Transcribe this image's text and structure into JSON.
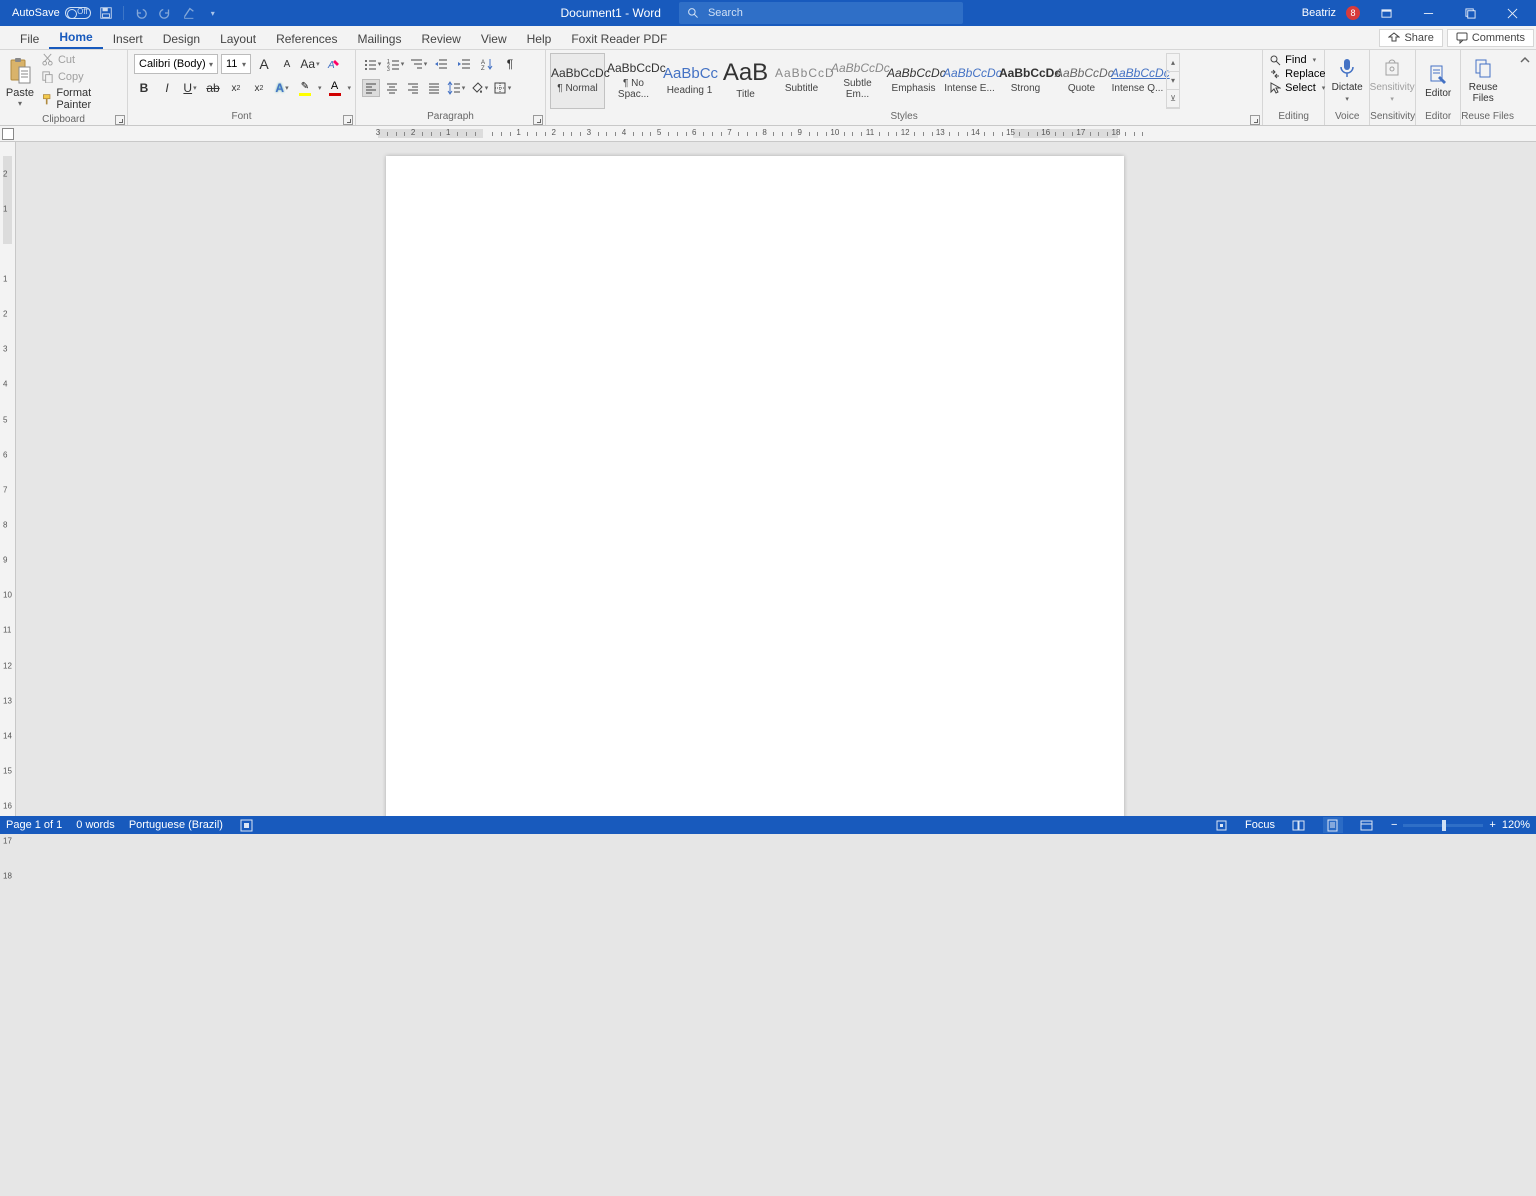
{
  "title": {
    "autosave": "AutoSave",
    "off": "Off",
    "doc": "Document1  -  Word",
    "search_ph": "Search",
    "user": "Beatriz",
    "badge": "8"
  },
  "tabs": {
    "file": "File",
    "home": "Home",
    "insert": "Insert",
    "design": "Design",
    "layout": "Layout",
    "references": "References",
    "mailings": "Mailings",
    "review": "Review",
    "view": "View",
    "help": "Help",
    "foxit": "Foxit Reader PDF",
    "share": "Share",
    "comments": "Comments"
  },
  "clip": {
    "paste": "Paste",
    "cut": "Cut",
    "copy": "Copy",
    "fp": "Format Painter",
    "label": "Clipboard"
  },
  "font": {
    "name": "Calibri (Body)",
    "size": "11",
    "Aa": "Aa",
    "label": "Font"
  },
  "para": {
    "label": "Paragraph"
  },
  "styles": {
    "label": "Styles",
    "items": [
      {
        "prev": "AaBbCcDc",
        "name": "¶ Normal",
        "pstyle": ""
      },
      {
        "prev": "AaBbCcDc",
        "name": "¶ No Spac...",
        "pstyle": ""
      },
      {
        "prev": "AaBbCc",
        "name": "Heading 1",
        "pstyle": "color:#4472c4;font-size:15px;"
      },
      {
        "prev": "AaB",
        "name": "Title",
        "pstyle": "font-size:24px;"
      },
      {
        "prev": "AaBbCcD",
        "name": "Subtitle",
        "pstyle": "color:#888;letter-spacing:1px;"
      },
      {
        "prev": "AaBbCcDc",
        "name": "Subtle Em...",
        "pstyle": "color:#888;font-style:italic;"
      },
      {
        "prev": "AaBbCcDc",
        "name": "Emphasis",
        "pstyle": "font-style:italic;"
      },
      {
        "prev": "AaBbCcDc",
        "name": "Intense E...",
        "pstyle": "color:#4472c4;font-style:italic;"
      },
      {
        "prev": "AaBbCcDc",
        "name": "Strong",
        "pstyle": "font-weight:bold;"
      },
      {
        "prev": "AaBbCcDc",
        "name": "Quote",
        "pstyle": "font-style:italic;color:#666;"
      },
      {
        "prev": "AaBbCcDc",
        "name": "Intense Q...",
        "pstyle": "color:#4472c4;font-style:italic;text-decoration:underline;"
      }
    ]
  },
  "edit": {
    "find": "Find",
    "replace": "Replace",
    "select": "Select",
    "label": "Editing"
  },
  "big": {
    "dictate": "Dictate",
    "sensitivity": "Sensitivity",
    "editor": "Editor",
    "reuse": "Reuse Files",
    "voice": "Voice",
    "sens": "Sensitivity",
    "ed": "Editor",
    "rf": "Reuse Files"
  },
  "status": {
    "page": "Page 1 of 1",
    "words": "0 words",
    "lang": "Portuguese (Brazil)",
    "focus": "Focus",
    "zoom": "120%"
  },
  "ruler": {
    "cm_per_unit": 1,
    "page_w_cm": 21,
    "margin_cm": 3,
    "page_h_visible_cm": 18,
    "top_margin_cm": 2.5
  }
}
